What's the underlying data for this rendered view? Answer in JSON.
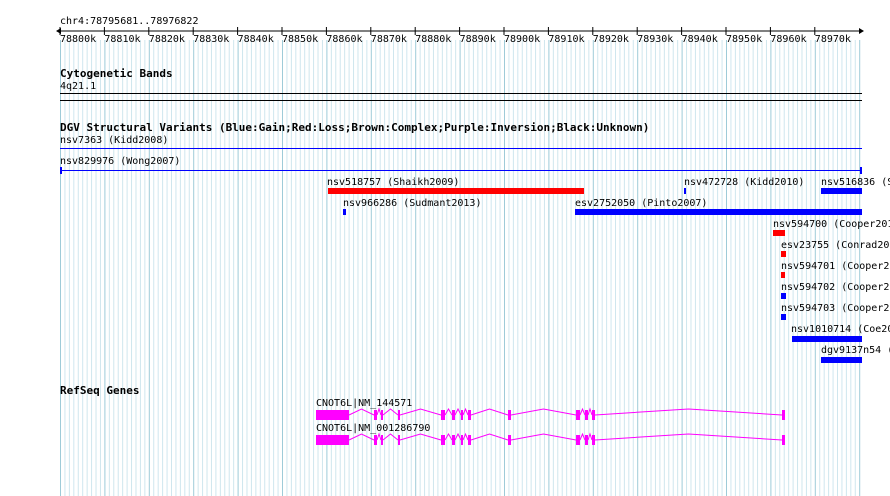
{
  "region": {
    "label": "chr4:78795681..78976822",
    "ticks": [
      "78800k",
      "78810k",
      "78820k",
      "78830k",
      "78840k",
      "78850k",
      "78860k",
      "78870k",
      "78880k",
      "78890k",
      "78900k",
      "78910k",
      "78920k",
      "78930k",
      "78940k",
      "78950k",
      "78960k",
      "78970k"
    ]
  },
  "tracks": {
    "cytoband": {
      "title": "Cytogenetic Bands",
      "band": "4q21.1"
    },
    "dgv": {
      "title": "DGV Structural Variants (Blue:Gain;Red:Loss;Brown:Complex;Purple:Inversion;Black:Unknown)",
      "features": [
        {
          "label": "nsv7363 (Kidd2008)",
          "color": "#0000ff",
          "type": "line"
        },
        {
          "label": "nsv829976 (Wong2007)",
          "color": "#0000ff",
          "type": "line"
        },
        {
          "label": "nsv518757 (Shaikh2009)",
          "color": "#ff0000",
          "type": "bar"
        },
        {
          "label": "nsv472728 (Kidd2010)",
          "color": "#0000ff",
          "type": "bar"
        },
        {
          "label": "nsv516836 (S",
          "color": "#0000ff",
          "type": "bar"
        },
        {
          "label": "nsv966286 (Sudmant2013)",
          "color": "#0000ff",
          "type": "bar"
        },
        {
          "label": "esv2752050 (Pinto2007)",
          "color": "#0000ff",
          "type": "bar"
        },
        {
          "label": "nsv594700 (Cooper201",
          "color": "#ff0000",
          "type": "bar"
        },
        {
          "label": "esv23755 (Conrad200",
          "color": "#ff0000",
          "type": "bar"
        },
        {
          "label": "nsv594701 (Cooper20",
          "color": "#ff0000",
          "type": "bar"
        },
        {
          "label": "nsv594702 (Cooper20",
          "color": "#0000ff",
          "type": "bar"
        },
        {
          "label": "nsv594703 (Cooper20",
          "color": "#0000ff",
          "type": "bar"
        },
        {
          "label": "nsv1010714 (Coe20",
          "color": "#0000ff",
          "type": "bar"
        },
        {
          "label": "dgv9137n54 (",
          "color": "#0000ff",
          "type": "bar"
        }
      ]
    },
    "refseq": {
      "title": "RefSeq Genes",
      "color": "#ff00ff",
      "genes": [
        {
          "label": "CNOT6L|NM_144571"
        },
        {
          "label": "CNOT6L|NM_001286790"
        }
      ]
    }
  }
}
